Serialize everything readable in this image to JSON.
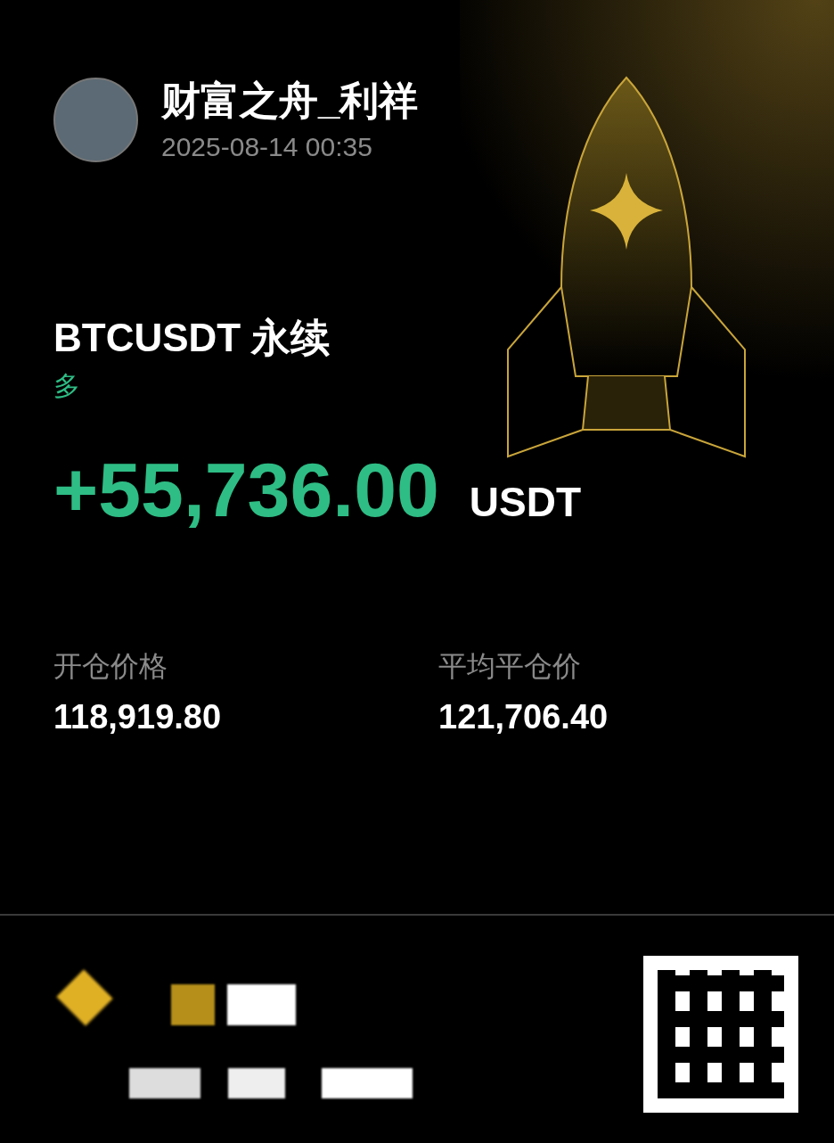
{
  "user": {
    "name": "财富之舟_利祥",
    "time": "2025-08-14 00:35"
  },
  "position": {
    "symbol": "BTCUSDT 永续",
    "side": {
      "text": "多",
      "kind": "long"
    },
    "pnl": "+55,736.00",
    "currency": "USDT"
  },
  "stats": [
    {
      "label": "开仓价格",
      "value": "118,919.80"
    },
    {
      "label": "平均平仓价",
      "value": "121,706.40"
    }
  ]
}
